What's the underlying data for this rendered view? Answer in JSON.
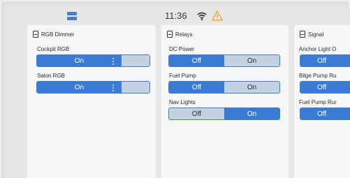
{
  "status_bar": {
    "time": "11:36"
  },
  "icons": {
    "menu": "menu-icon",
    "wifi": "wifi-icon",
    "warning": "warning-icon",
    "card_header": "switch-icon"
  },
  "colors": {
    "accent": "#3a7bd5",
    "inactive": "#c3d2e3",
    "warning": "#f0a030"
  },
  "cards": {
    "rgb_dimmer": {
      "title": "RGB Dimmer",
      "rows": [
        {
          "label": "Cockpit RGB",
          "state": "On",
          "level": 0.75
        },
        {
          "label": "Salon RGB",
          "state": "On",
          "level": 0.75
        }
      ]
    },
    "relays": {
      "title": "Relays",
      "off_label": "Off",
      "on_label": "On",
      "rows": [
        {
          "label": "DC Power",
          "state": "Off"
        },
        {
          "label": "Fuel Pump",
          "state": "Off"
        },
        {
          "label": "Nav Lights",
          "state": "On"
        }
      ]
    },
    "signal": {
      "title": "Signal",
      "off_label": "Off",
      "rows": [
        {
          "label": "Anchor Light O",
          "state": "Off"
        },
        {
          "label": "Bilge Pump Ru",
          "state": "Off"
        },
        {
          "label": "Fuel Pump Rur",
          "state": "Off"
        }
      ]
    }
  }
}
